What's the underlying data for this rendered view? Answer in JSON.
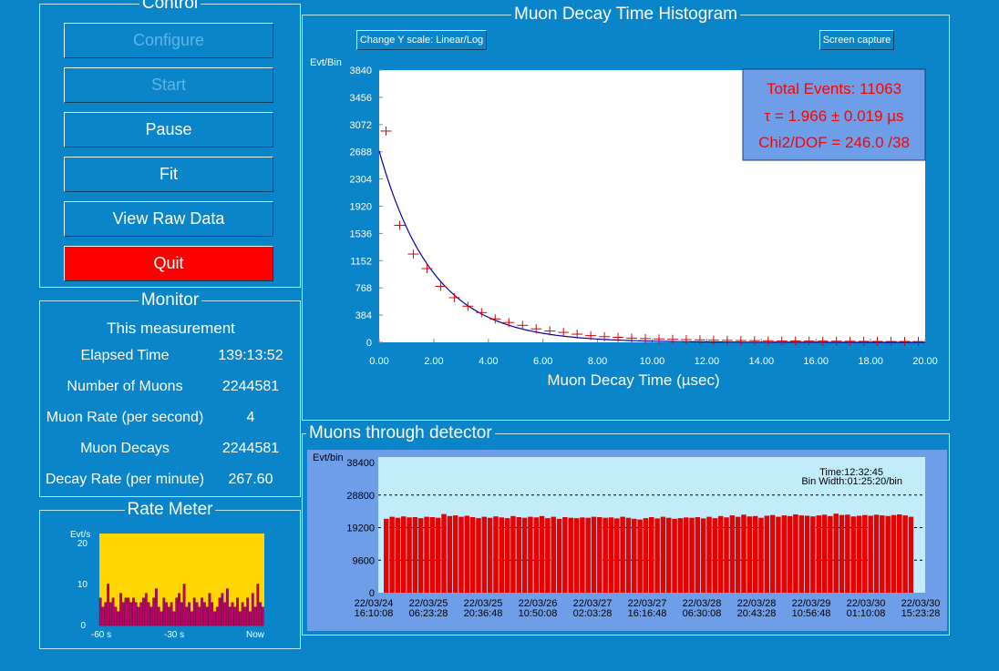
{
  "control": {
    "title": "Control",
    "buttons": {
      "configure": "Configure",
      "start": "Start",
      "pause": "Pause",
      "fit": "Fit",
      "view_raw": "View Raw Data",
      "quit": "Quit"
    }
  },
  "monitor": {
    "title": "Monitor",
    "subtitle": "This measurement",
    "rows": [
      {
        "label": "Elapsed Time",
        "value": "139:13:52"
      },
      {
        "label": "Number of Muons",
        "value": "2244581"
      },
      {
        "label": "Muon Rate (per second)",
        "value": "4"
      },
      {
        "label": "Muon Decays",
        "value": "2244581"
      },
      {
        "label": "Decay Rate (per minute)",
        "value": "267.60"
      }
    ]
  },
  "rate_meter": {
    "title": "Rate Meter",
    "ylabel": "Evt/s",
    "yticks": [
      "20",
      "10",
      "0"
    ],
    "xticks": [
      "-60 s",
      "-30 s",
      "Now"
    ]
  },
  "histogram": {
    "title": "Muon Decay Time Histogram",
    "scale_button": "Change Y scale: Linear/Log",
    "capture_button": "Screen capture",
    "ylabel": "Evt/Bin",
    "xlabel": "Muon Decay Time (µsec)",
    "stats": {
      "total": "Total Events: 11063",
      "tau": "τ = 1.966 ± 0.019 µs",
      "chi2": "Chi2/DOF = 246.0 /38"
    }
  },
  "detector": {
    "title": "Muons through detector",
    "ylabel": "Evt/bin",
    "time": "Time:12:32:45",
    "bin_width": "Bin Width:01:25:20/bin"
  },
  "colors": {
    "background": "#0a85c9",
    "quit": "#ff0000",
    "bars": "#e60000",
    "meter_bg": "#ffd700",
    "meter_bars": "#c0006e",
    "fit_line": "#0000aa",
    "marker": "#e00000",
    "stats_bg": "#6f9ee8",
    "stats_text": "#ff0000",
    "detector_plot_bg": "#c3ecfb",
    "detector_frame": "#6f9ee8"
  },
  "chart_data": [
    {
      "type": "scatter",
      "title": "Muon Decay Time Histogram",
      "xlabel": "Muon Decay Time (µsec)",
      "ylabel": "Evt/Bin",
      "xlim": [
        0,
        20
      ],
      "ylim": [
        0,
        3840
      ],
      "xticks": [
        "0.00",
        "2.00",
        "4.00",
        "6.00",
        "8.00",
        "10.00",
        "12.00",
        "14.00",
        "16.00",
        "18.00",
        "20.00"
      ],
      "yticks": [
        "3840",
        "3456",
        "3072",
        "2688",
        "2304",
        "1920",
        "1536",
        "1152",
        "768",
        "384",
        "0"
      ],
      "x": [
        0.25,
        0.75,
        1.25,
        1.75,
        2.25,
        2.75,
        3.25,
        3.75,
        4.25,
        4.75,
        5.25,
        5.75,
        6.25,
        6.75,
        7.25,
        7.75,
        8.25,
        8.75,
        9.25,
        9.75,
        10.25,
        10.75,
        11.25,
        11.75,
        12.25,
        12.75,
        13.25,
        13.75,
        14.25,
        14.75,
        15.25,
        15.75,
        16.25,
        16.75,
        17.25,
        17.75,
        18.25,
        18.75,
        19.25,
        19.75
      ],
      "y": [
        2980,
        1650,
        1245,
        1040,
        790,
        630,
        510,
        420,
        330,
        280,
        240,
        190,
        160,
        140,
        115,
        95,
        80,
        70,
        60,
        52,
        48,
        42,
        38,
        35,
        30,
        28,
        26,
        24,
        22,
        20,
        19,
        18,
        17,
        16,
        15,
        14,
        13,
        12,
        12,
        11
      ],
      "fit": {
        "tau": 1.966,
        "amplitude": 2700
      }
    },
    {
      "type": "bar",
      "title": "Muons through detector",
      "ylabel": "Evt/bin",
      "ylim": [
        0,
        38400
      ],
      "yticks": [
        "38400",
        "28800",
        "19200",
        "9600",
        "0"
      ],
      "xticks": [
        "22/03/24\n16:10:08",
        "22/03/25\n06:23:28",
        "22/03/25\n20:36:48",
        "22/03/26\n10:50:08",
        "22/03/27\n02:03:28",
        "22/03/27\n16:16:48",
        "22/03/28\n06:30:08",
        "22/03/28\n20:43:28",
        "22/03/29\n10:56:48",
        "22/03/30\n01:10:08",
        "22/03/30\n15:23:28"
      ],
      "values": [
        21800,
        22400,
        22100,
        22500,
        22200,
        22300,
        22000,
        22400,
        22300,
        22100,
        23200,
        22600,
        22800,
        22400,
        22700,
        22300,
        22000,
        22400,
        22100,
        22500,
        22200,
        22000,
        22600,
        22300,
        22100,
        22400,
        22200,
        22600,
        22000,
        22400,
        21800,
        22300,
        22100,
        22000,
        22200,
        22100,
        22400,
        22300,
        22100,
        22200,
        21900,
        22400,
        22100,
        21800,
        21600,
        22000,
        22300,
        21900,
        22400,
        22100,
        21800,
        22000,
        22200,
        22100,
        22300,
        21900,
        22400,
        22000,
        22600,
        22200,
        22800,
        22400,
        23000,
        22500,
        22600,
        22100,
        22700,
        22900,
        22400,
        22800,
        22600,
        23100,
        22800,
        22700,
        22500,
        22800,
        23000,
        22600,
        23300,
        22900,
        23000,
        22500,
        22700,
        22900,
        22700,
        23000,
        22800,
        22600,
        22900,
        23100,
        22800,
        22400
      ],
      "grid": "dashed"
    },
    {
      "type": "bar",
      "title": "Rate Meter",
      "ylabel": "Evt/s",
      "ylim": [
        0,
        20
      ],
      "xticks": [
        "-60 s",
        "-30 s",
        "Now"
      ],
      "values": [
        6,
        4,
        5,
        9,
        5,
        6,
        4,
        3,
        7,
        5,
        6,
        6,
        5,
        6,
        5,
        4,
        5,
        6,
        7,
        5,
        4,
        6,
        8,
        4,
        3,
        6,
        5,
        4,
        5,
        3,
        6,
        7,
        5,
        9,
        4,
        5,
        3,
        6,
        5,
        4,
        6,
        5,
        4,
        7,
        5,
        3,
        4,
        6,
        7,
        5,
        8,
        4,
        5,
        4,
        6,
        3,
        5,
        4,
        6,
        3,
        7,
        4,
        9,
        5,
        4
      ]
    }
  ]
}
